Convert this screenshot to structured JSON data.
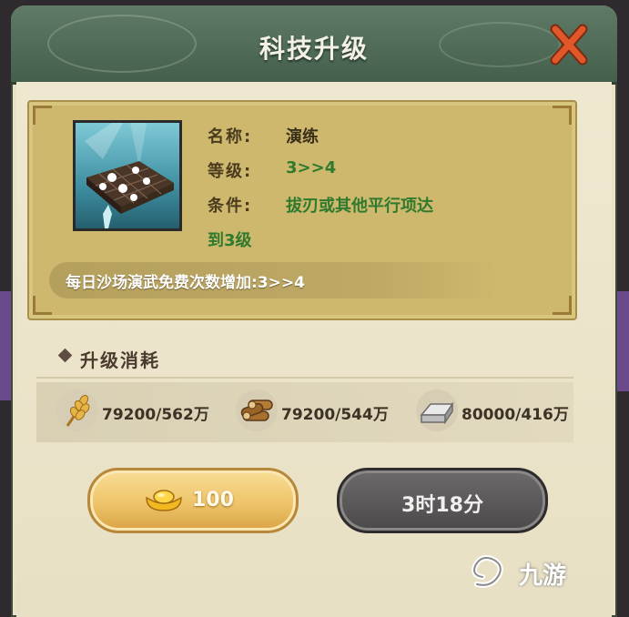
{
  "dialog": {
    "title": "科技升级",
    "close_icon": "close-x-icon"
  },
  "tech": {
    "image_icon": "training-board-icon",
    "name_label": "名称:",
    "name_value": "演练",
    "level_label": "等级:",
    "level_value": "3>>4",
    "condition_label": "条件:",
    "condition_value_line1": "拔刃或其他平行项达",
    "condition_value_line2": "到3级",
    "effect": "每日沙场演武免费次数增加:3>>4"
  },
  "cost": {
    "section_title": "升级消耗",
    "items": [
      {
        "icon": "wheat-icon",
        "text": "79200/562万"
      },
      {
        "icon": "wood-logs-icon",
        "text": "79200/544万"
      },
      {
        "icon": "iron-ingot-icon",
        "text": "80000/416万"
      }
    ]
  },
  "actions": {
    "gold_button_icon": "gold-ingot-icon",
    "gold_button_value": "100",
    "time_button_label": "3时18分"
  },
  "watermark": {
    "text": "九游"
  },
  "colors": {
    "header_green": "#4f6b57",
    "card_gold": "#cdb86d",
    "value_green": "#2f7a2c",
    "gold_button": "#eec46a",
    "gray_button": "#5a5858"
  }
}
